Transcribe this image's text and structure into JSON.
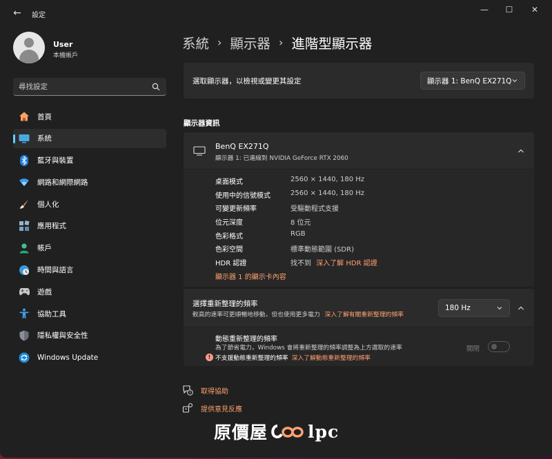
{
  "window": {
    "app_title": "設定",
    "back": "←",
    "minimize": "—",
    "maximize": "☐",
    "close": "✕"
  },
  "profile": {
    "name": "User",
    "account": "本機帳戶"
  },
  "search": {
    "placeholder": "尋找設定"
  },
  "sidebar": {
    "items": [
      {
        "label": "首頁",
        "icon": "home-icon"
      },
      {
        "label": "系統",
        "icon": "system-icon",
        "active": true
      },
      {
        "label": "藍牙與裝置",
        "icon": "bluetooth-icon"
      },
      {
        "label": "網路和網際網路",
        "icon": "wifi-icon"
      },
      {
        "label": "個人化",
        "icon": "brush-icon"
      },
      {
        "label": "應用程式",
        "icon": "apps-icon"
      },
      {
        "label": "帳戶",
        "icon": "person-icon"
      },
      {
        "label": "時間與語言",
        "icon": "globe-clock-icon"
      },
      {
        "label": "遊戲",
        "icon": "gamepad-icon"
      },
      {
        "label": "協助工具",
        "icon": "accessibility-icon"
      },
      {
        "label": "隱私權與安全性",
        "icon": "shield-icon"
      },
      {
        "label": "Windows Update",
        "icon": "update-icon"
      }
    ]
  },
  "breadcrumb": {
    "items": [
      "系統",
      "顯示器",
      "進階型顯示器"
    ],
    "separator": "›"
  },
  "select_display": {
    "label": "選取顯示器，以檢視或變更其設定",
    "value": "顯示器 1: BenQ EX271Q"
  },
  "display_info": {
    "section_title": "顯示器資訊",
    "name": "BenQ EX271Q",
    "connection": "顯示器 1: 已連線到 NVIDIA GeForce RTX 2060",
    "rows": [
      {
        "label": "桌面模式",
        "value": "2560 × 1440, 180 Hz"
      },
      {
        "label": "使用中的信號模式",
        "value": "2560 × 1440, 180 Hz"
      },
      {
        "label": "可變更新頻率",
        "value": "受驅動程式支援"
      },
      {
        "label": "位元深度",
        "value": "8 位元"
      },
      {
        "label": "色彩格式",
        "value": "RGB"
      },
      {
        "label": "色彩空間",
        "value": "標準動態範圍 (SDR)"
      },
      {
        "label": "HDR 認證",
        "value": "找不到",
        "link": "深入了解 HDR 認證"
      }
    ],
    "adapter_link": "顯示器 1 的顯示卡內容"
  },
  "refresh_rate": {
    "title": "選擇重新整理的頻率",
    "description": "較高的速率可更順暢地移動，但也使用更多電力",
    "link": "深入了解有關重新整理的頻率",
    "value": "180 Hz"
  },
  "dynamic_refresh": {
    "title": "動態重新整理的頻率",
    "description": "為了節省電力，Windows 會將重新整理的頻率調整為上方選取的速率",
    "warning": "不支援動態重新整理的頻率",
    "warning_link": "深入了解動態重新整理的頻率",
    "toggle_label": "關閉",
    "toggle_on": false
  },
  "help": {
    "get_help": "取得協助",
    "feedback": "提供意見反應"
  },
  "watermark": {
    "left": "原價屋",
    "right": "lpc"
  },
  "colors": {
    "accent_link": "#ffa070",
    "active_indicator": "#60cdff",
    "background": "#202020",
    "card": "#2b2b2b"
  }
}
